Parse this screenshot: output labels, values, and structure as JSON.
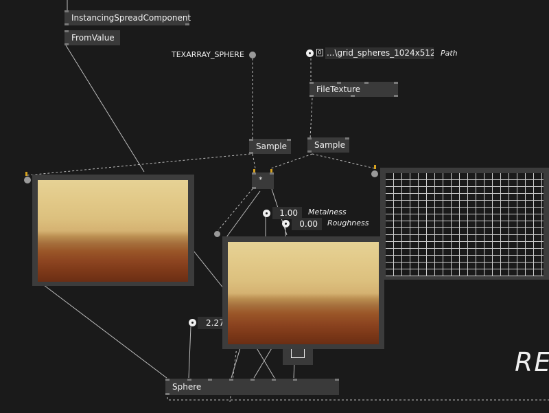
{
  "nodes": {
    "instancing": "InstancingSpreadComponent",
    "fromvalue": "FromValue",
    "filetexture": "FileTexture",
    "sample1": "Sample",
    "sample2": "Sample",
    "multiply": "*",
    "sphere": "Sphere"
  },
  "labels": {
    "texarray": "TEXARRAY_SPHERE",
    "path_value": "...\\grid_spheres_1024x512.",
    "path_label": "Path",
    "path_index": "0",
    "metalness_value": "1.00",
    "metalness_label": "Metalness",
    "roughness_value": "0.00",
    "roughness_label": "Roughness",
    "size_value": "2.27",
    "big_text": "RE"
  },
  "colors": {
    "background": "#1a1a1a",
    "node": "#3a3a3a",
    "wire": "#bdbdbd",
    "pin_accent": "#d6a21e"
  }
}
